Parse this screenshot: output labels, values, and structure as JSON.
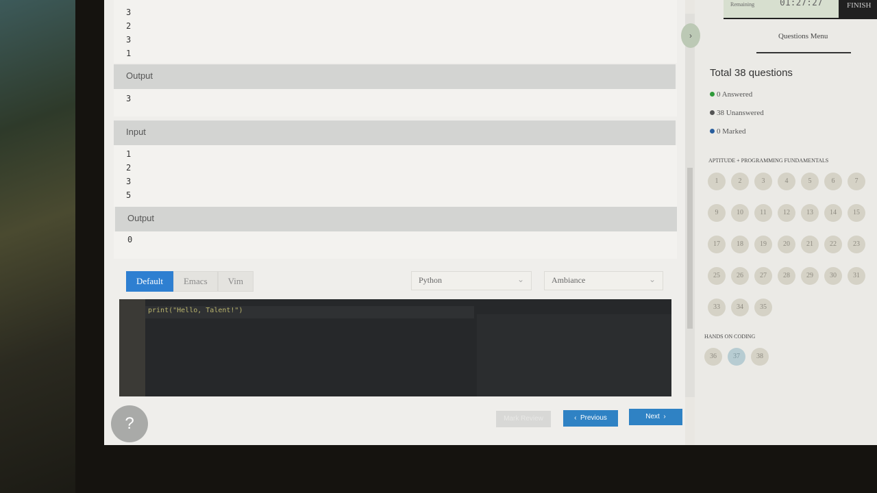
{
  "testcases": {
    "case1_input_tail": [
      "3",
      "2",
      "3",
      "1"
    ],
    "case1_output_label": "Output",
    "case1_output": "3",
    "case2_input_label": "Input",
    "case2_input": [
      "1",
      "2",
      "3",
      "5"
    ],
    "case2_output_label": "Output",
    "case2_output": "0"
  },
  "editor": {
    "keymaps": [
      "Default",
      "Emacs",
      "Vim"
    ],
    "language": "Python",
    "theme": "Ambiance",
    "code": "print(\"Hello, Talent!\")"
  },
  "timer": {
    "label": "Remaining",
    "time": "01:27:27",
    "finish_label": "FINISH"
  },
  "menu": {
    "title": "Questions Menu",
    "total": "Total 38 questions",
    "answered": "0 Answered",
    "unanswered": "38 Unanswered",
    "marked": "0 Marked",
    "section1": "APTITUDE + PROGRAMMING FUNDAMENTALS",
    "section2": "HANDS ON CODING",
    "section1_questions": [
      "1",
      "2",
      "3",
      "4",
      "5",
      "6",
      "7",
      "9",
      "10",
      "11",
      "12",
      "13",
      "14",
      "15",
      "17",
      "18",
      "19",
      "20",
      "21",
      "22",
      "23",
      "25",
      "26",
      "27",
      "28",
      "29",
      "30",
      "31",
      "33",
      "34",
      "35"
    ],
    "section2_questions": [
      "36",
      "37",
      "38"
    ],
    "current_question": "37"
  },
  "footer": {
    "help": "?",
    "mark_review": "Mark Review",
    "previous": "Previous",
    "next": "Next"
  },
  "colors": {
    "accent": "#2f82c4",
    "answered": "#2f9a3a",
    "unanswered": "#555555",
    "marked": "#2a5f9e"
  },
  "icons": {
    "collapse": "chevron-right-icon",
    "dropdown": "chevron-down-icon"
  }
}
